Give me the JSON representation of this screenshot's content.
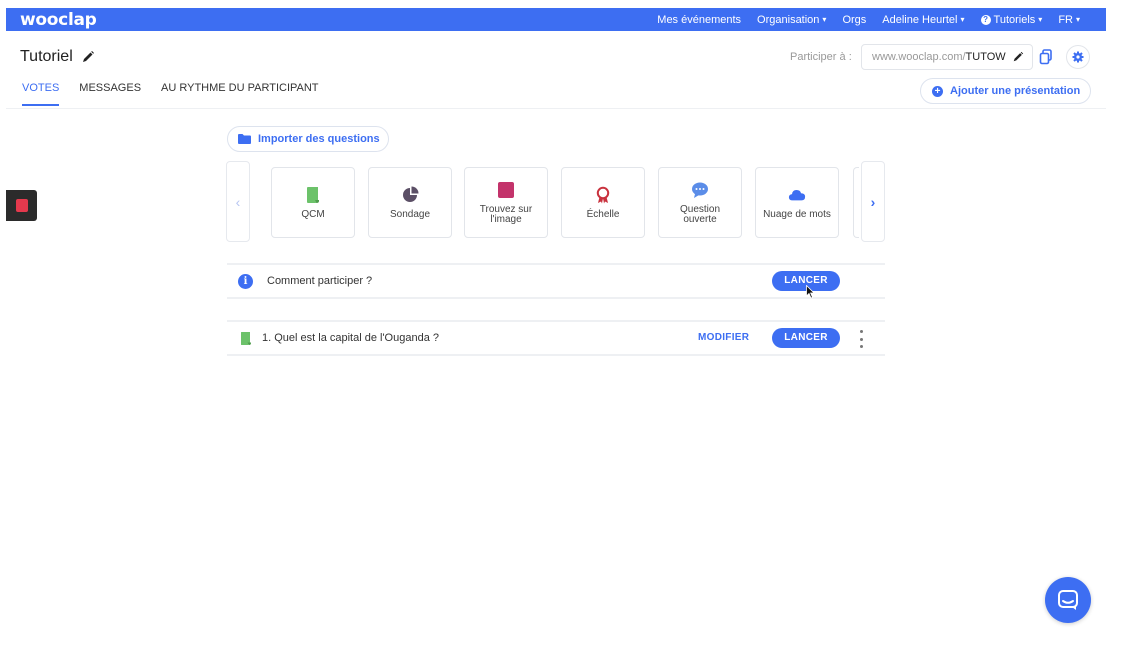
{
  "topbar": {
    "logo": "wooclap",
    "nav": [
      {
        "label": "Mes événements",
        "caret": false
      },
      {
        "label": "Organisation",
        "caret": true
      },
      {
        "label": "Orgs",
        "caret": false
      },
      {
        "label": "Adeline Heurtel",
        "caret": true
      },
      {
        "label": "Tutoriels",
        "caret": true
      },
      {
        "label": "FR",
        "caret": true
      }
    ],
    "tutoriels_icon": "question-icon"
  },
  "event": {
    "title": "Tutoriel",
    "participate_label": "Participer à :",
    "url_prefix": "www.wooclap.com/",
    "url_code": "TUTOW"
  },
  "tabs": [
    {
      "label": "VOTES",
      "active": true
    },
    {
      "label": "MESSAGES",
      "active": false
    },
    {
      "label": "AU RYTHME DU PARTICIPANT",
      "active": false
    }
  ],
  "add_presentation_label": "Ajouter une présentation",
  "import_label": "Importer des questions",
  "question_types": [
    {
      "label": "QCM",
      "icon": "qcm-icon",
      "color": "#6cc26a"
    },
    {
      "label": "Sondage",
      "icon": "pie-icon",
      "color": "#5b4f66"
    },
    {
      "label": "Trouvez sur l'image",
      "icon": "image-icon",
      "color": "#c3336b"
    },
    {
      "label": "Échelle",
      "icon": "ribbon-icon",
      "color": "#c9323e"
    },
    {
      "label": "Question ouverte",
      "icon": "speech-icon",
      "color": "#5b8de8"
    },
    {
      "label": "Nuage de mots",
      "icon": "cloud-icon",
      "color": "#3d6ef2"
    }
  ],
  "rows": {
    "how_to": {
      "text": "Comment participer ?",
      "launch": "LANCER"
    },
    "question": {
      "text": "1.  Quel est la capital de l'Ouganda ?",
      "modify": "MODIFIER",
      "launch": "LANCER"
    }
  },
  "colors": {
    "brand": "#3d6ef2",
    "record": "#e5394d"
  }
}
